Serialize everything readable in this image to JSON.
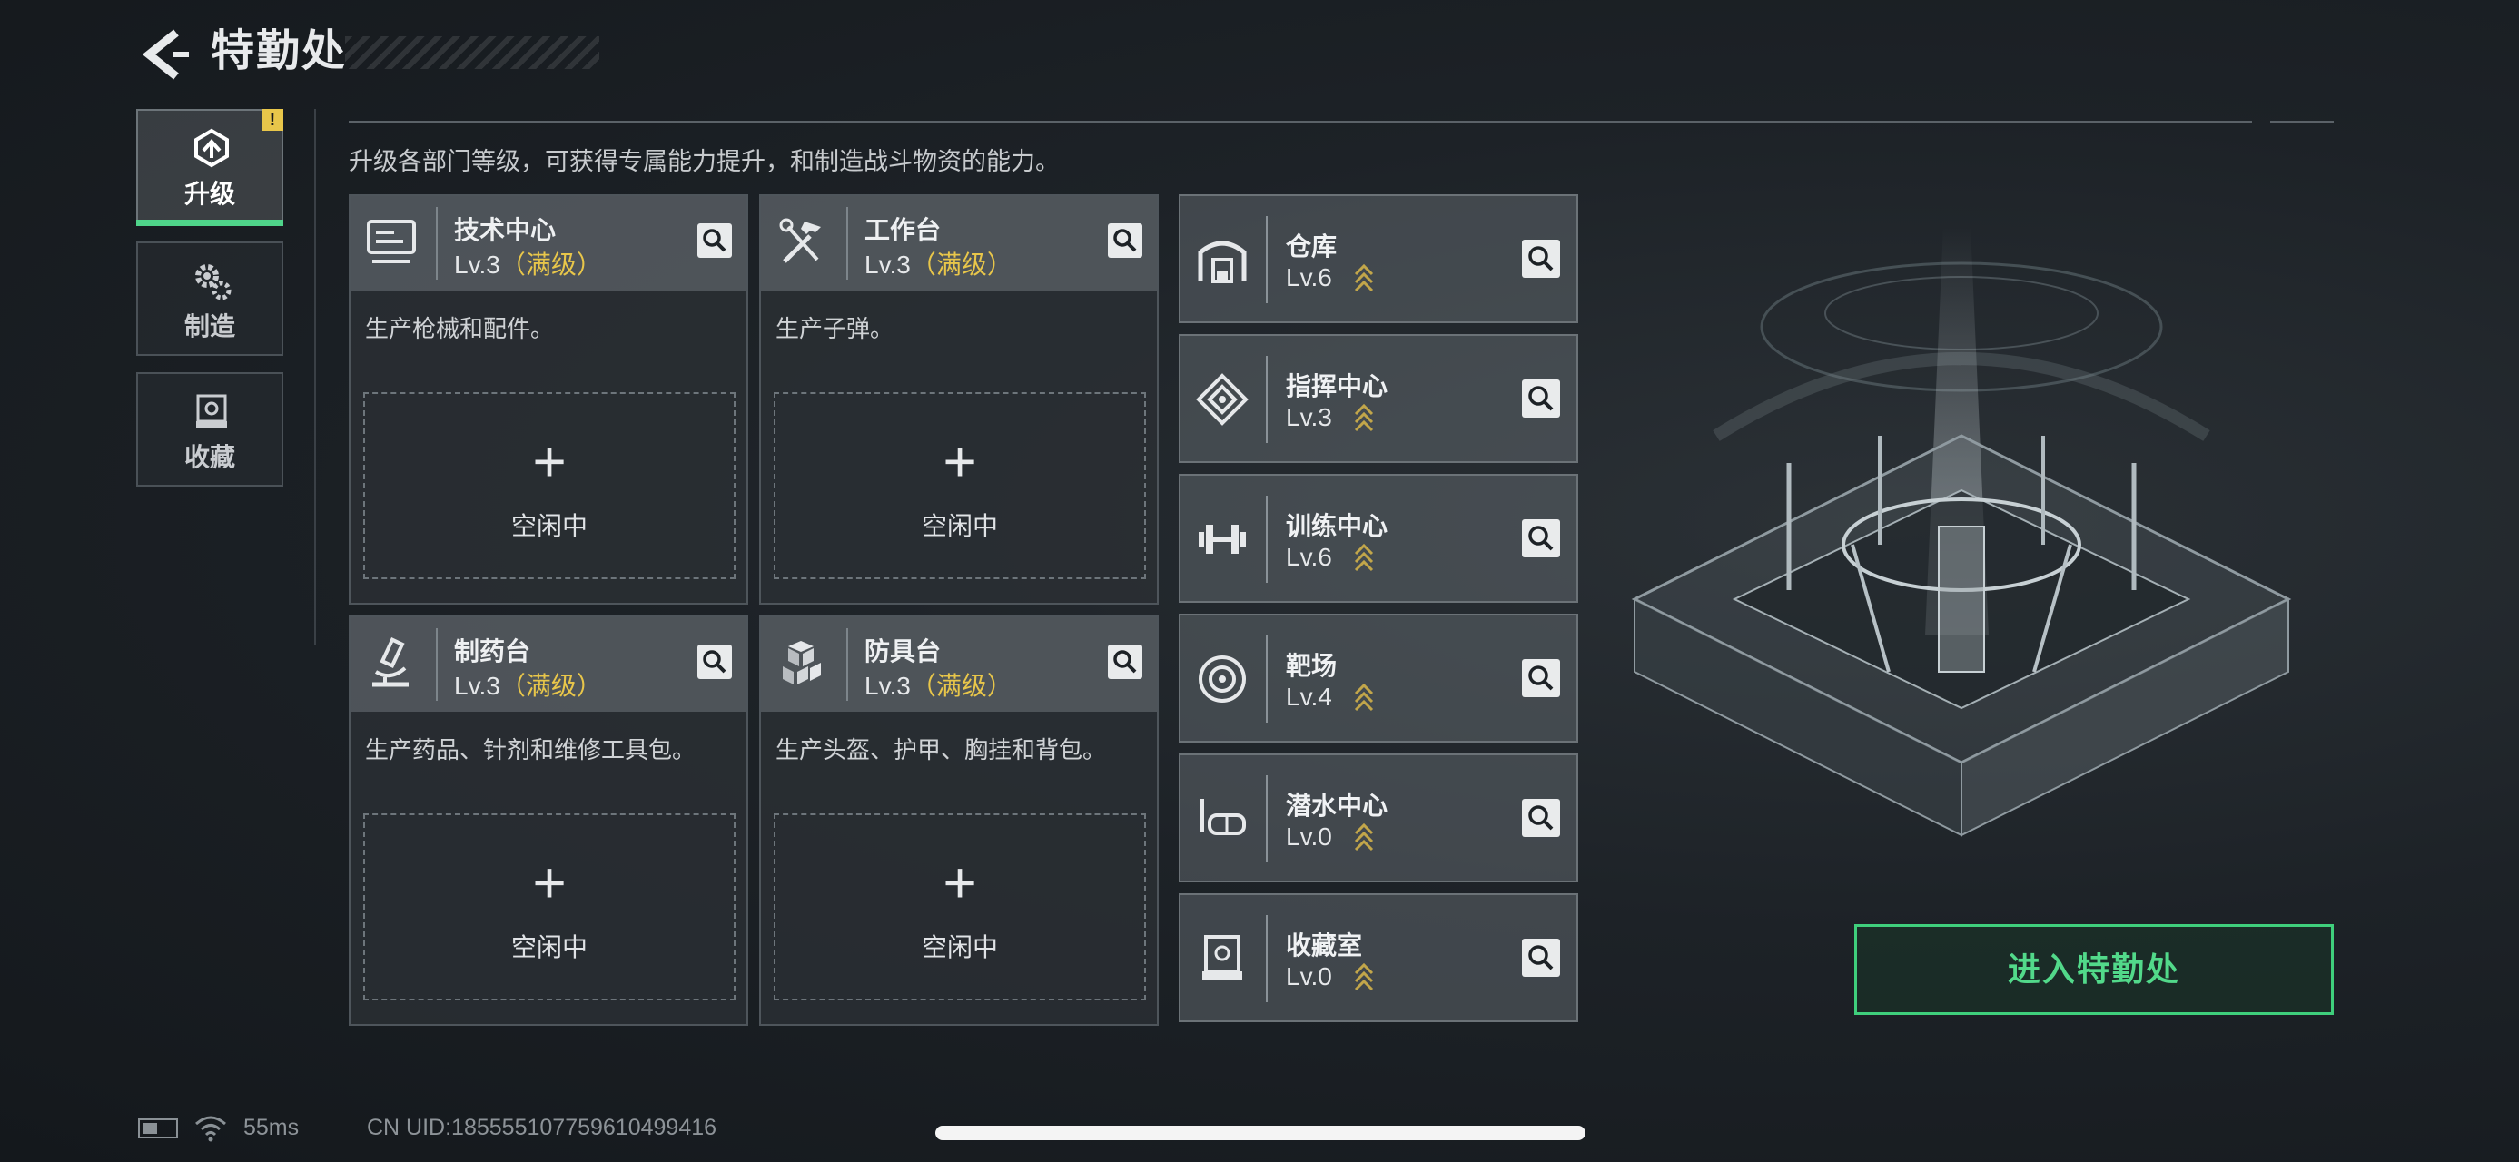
{
  "header": {
    "title": "特勤处"
  },
  "subtitle": "升级各部门等级，可获得专属能力提升，和制造战斗物资的能力。",
  "tabs": [
    {
      "label": "升级",
      "icon": "upgrade-icon",
      "active": true,
      "alert": "!"
    },
    {
      "label": "制造",
      "icon": "gears-icon",
      "active": false
    },
    {
      "label": "收藏",
      "icon": "collection-icon",
      "active": false
    }
  ],
  "workshops": [
    {
      "name": "技术中心",
      "level": "Lv.3",
      "max_label": "（满级）",
      "desc": "生产枪械和配件。",
      "slot_plus": "+",
      "slot_status": "空闲中",
      "icon": "monitor-icon"
    },
    {
      "name": "工作台",
      "level": "Lv.3",
      "max_label": "（满级）",
      "desc": "生产子弹。",
      "slot_plus": "+",
      "slot_status": "空闲中",
      "icon": "tools-icon"
    },
    {
      "name": "制药台",
      "level": "Lv.3",
      "max_label": "（满级）",
      "desc": "生产药品、针剂和维修工具包。",
      "slot_plus": "+",
      "slot_status": "空闲中",
      "icon": "microscope-icon"
    },
    {
      "name": "防具台",
      "level": "Lv.3",
      "max_label": "（满级）",
      "desc": "生产头盔、护甲、胸挂和背包。",
      "slot_plus": "+",
      "slot_status": "空闲中",
      "icon": "armor-icon"
    }
  ],
  "facilities": [
    {
      "name": "仓库",
      "level": "Lv.6",
      "icon": "warehouse-icon"
    },
    {
      "name": "指挥中心",
      "level": "Lv.3",
      "icon": "command-icon"
    },
    {
      "name": "训练中心",
      "level": "Lv.6",
      "icon": "dumbbell-icon"
    },
    {
      "name": "靶场",
      "level": "Lv.4",
      "icon": "target-icon"
    },
    {
      "name": "潜水中心",
      "level": "Lv.0",
      "icon": "diving-mask-icon"
    },
    {
      "name": "收藏室",
      "level": "Lv.0",
      "icon": "display-case-icon"
    }
  ],
  "enter_button": "进入特勤处",
  "footer": {
    "ping": "55ms",
    "uid": "CN UID:1855551077596104994​16"
  },
  "colors": {
    "accent_green": "#4fd48a",
    "max_gold": "#e8c64a"
  }
}
